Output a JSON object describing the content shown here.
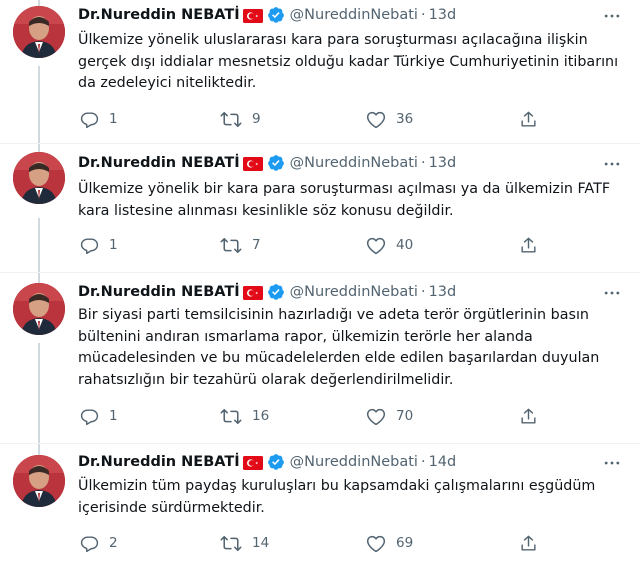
{
  "tweets": [
    {
      "name": "Dr.Nureddin NEBATİ",
      "handle": "@NureddinNebati",
      "separator": "·",
      "time": "13d",
      "text": "Ülkemize yönelik uluslararası kara para soruşturması açılacağına ilişkin\ngerçek dışı iddialar mesnetsiz olduğu kadar Türkiye Cumhuriyetinin itibarını\nda zedeleyici niteliktedir.",
      "replies": "1",
      "retweets": "9",
      "likes": "36"
    },
    {
      "name": "Dr.Nureddin NEBATİ",
      "handle": "@NureddinNebati",
      "separator": "·",
      "time": "13d",
      "text": "Ülkemize yönelik bir kara para soruşturması açılması ya da ülkemizin FATF\nkara listesine alınması kesinlikle söz konusu değildir.",
      "replies": "1",
      "retweets": "7",
      "likes": "40"
    },
    {
      "name": "Dr.Nureddin NEBATİ",
      "handle": "@NureddinNebati",
      "separator": "·",
      "time": "13d",
      "text": "Bir siyasi parti temsilcisinin hazırladığı ve adeta terör örgütlerinin basın\nbültenini andıran ısmarlama rapor, ülkemizin terörle her alanda\nmücadelesinden ve bu mücadelelerden elde edilen başarılardan duyulan\nrahatsızlığın bir tezahürü olarak değerlendirilmelidir.",
      "replies": "1",
      "retweets": "16",
      "likes": "70"
    },
    {
      "name": "Dr.Nureddin NEBATİ",
      "handle": "@NureddinNebati",
      "separator": "·",
      "time": "14d",
      "text": "Ülkemizin tüm paydaş kuruluşları bu kapsamdaki çalışmalarını eşgüdüm\niçerisinde sürdürmektedir.",
      "replies": "2",
      "retweets": "14",
      "likes": "69"
    }
  ],
  "colors": {
    "text": "#0f1419",
    "secondary": "#536471",
    "verified": "#1d9bf0",
    "flag_red": "#e30a17",
    "thread_line": "#cfd9de"
  },
  "icons": [
    "more-icon",
    "reply-icon",
    "retweet-icon",
    "like-icon",
    "share-icon",
    "verified-badge-icon",
    "turkish-flag-icon"
  ]
}
